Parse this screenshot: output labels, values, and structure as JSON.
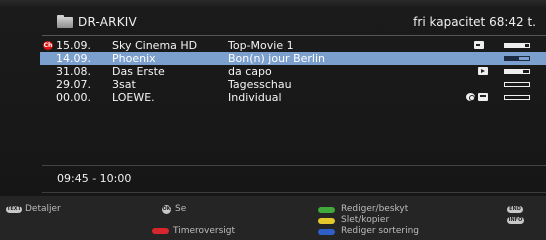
{
  "header": {
    "title": "DR-ARKIV",
    "capacity": "fri kapacitet 68:42 t."
  },
  "recordings": [
    {
      "date": "15.09.",
      "channel": "Sky Cinema HD",
      "title": "Top-Movie 1",
      "locked": true,
      "lock_label": "Ch",
      "icon": "key-icon",
      "progress": 0.85,
      "selected": false
    },
    {
      "date": "14.09.",
      "channel": "Phoenix",
      "title": "Bon(n) jour Berlin",
      "locked": false,
      "icon": "",
      "progress": 0.6,
      "selected": true
    },
    {
      "date": "31.08.",
      "channel": "Das Erste",
      "title": "da capo",
      "locked": false,
      "icon": "play-icon",
      "progress": 0.75,
      "selected": false
    },
    {
      "date": "29.07.",
      "channel": "3sat",
      "title": "Tagesschau",
      "locked": false,
      "icon": "",
      "progress": 0.0,
      "selected": false
    },
    {
      "date": "00.00.",
      "channel": "LOEWE.",
      "title": "Individual",
      "locked": false,
      "icon": "timer-cut-icon",
      "progress": 0.0,
      "selected": false
    }
  ],
  "time_range": "09:45 - 10:00",
  "footer": {
    "text_key": "TEXT",
    "details": "Detaljer",
    "ok_key": "OK",
    "see": "Se",
    "timer_overview": "Timeroversigt",
    "edit_protect": "Rediger/beskyt",
    "delete_copy": "Slet/kopier",
    "edit_sort": "Rediger sortering",
    "end_key": "END",
    "info_key": "INFO"
  },
  "colors": {
    "selection": "#7ca0cd",
    "red": "#d8262e",
    "green": "#3faa3a",
    "yellow": "#e3c82c",
    "blue": "#2e5fc8"
  }
}
